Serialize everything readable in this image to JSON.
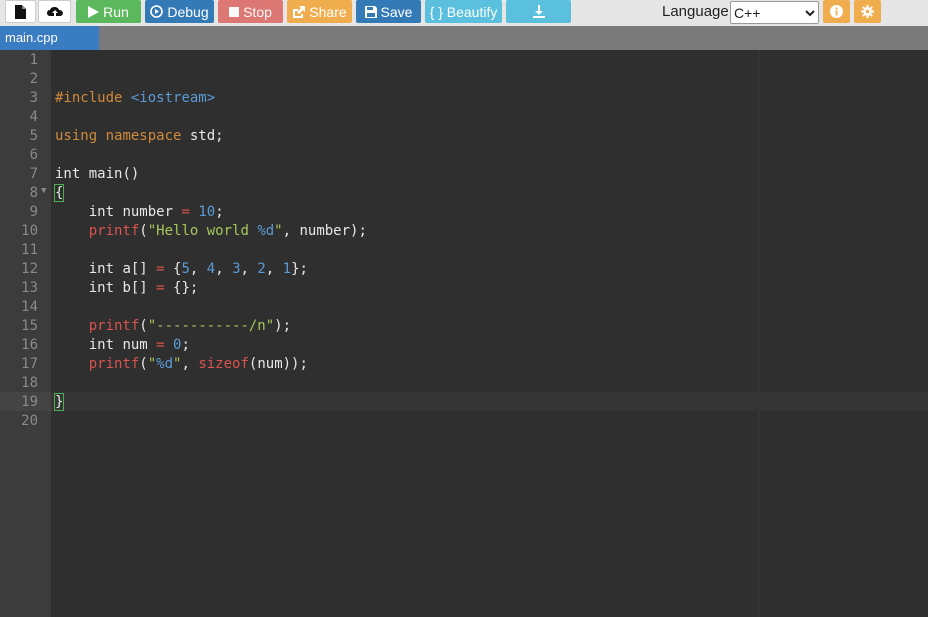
{
  "toolbar": {
    "new_file_icon": "file-icon",
    "upload_icon": "cloud-upload-icon",
    "run_label": "Run",
    "debug_label": "Debug",
    "stop_label": "Stop",
    "share_label": "Share",
    "save_label": "Save",
    "beautify_label": "{ } Beautify",
    "download_icon": "download-icon",
    "language_label": "Language",
    "language_value": "C++",
    "info_icon": "info-icon",
    "settings_icon": "gear-icon",
    "colors": {
      "run": "#5cb85c",
      "debug": "#337ab7",
      "stop": "#d9534f",
      "share": "#f0ad4e",
      "save": "#337ab7",
      "beautify": "#5bc0de",
      "download": "#5bc0de",
      "info": "#f0ad4e",
      "settings": "#f0ad4e"
    }
  },
  "tabs": [
    {
      "label": "main.cpp",
      "active": true
    }
  ],
  "editor": {
    "line_numbers": [
      "1",
      "2",
      "3",
      "4",
      "5",
      "6",
      "7",
      "8",
      "9",
      "10",
      "11",
      "12",
      "13",
      "14",
      "15",
      "16",
      "17",
      "18",
      "19",
      "20"
    ],
    "lines": [
      "",
      "",
      "#include <iostream>",
      "",
      "using namespace std;",
      "",
      "int main()",
      "{",
      "    int number = 10;",
      "    printf(\"Hello world %d\", number);",
      "",
      "    int a[] = {5, 4, 3, 2, 1};",
      "    int b[] = {};",
      "",
      "    printf(\"-----------/n\");",
      "    int num = 0;",
      "    printf(\"%d\", sizeof(num));",
      "",
      "}",
      ""
    ],
    "active_line": 19
  }
}
